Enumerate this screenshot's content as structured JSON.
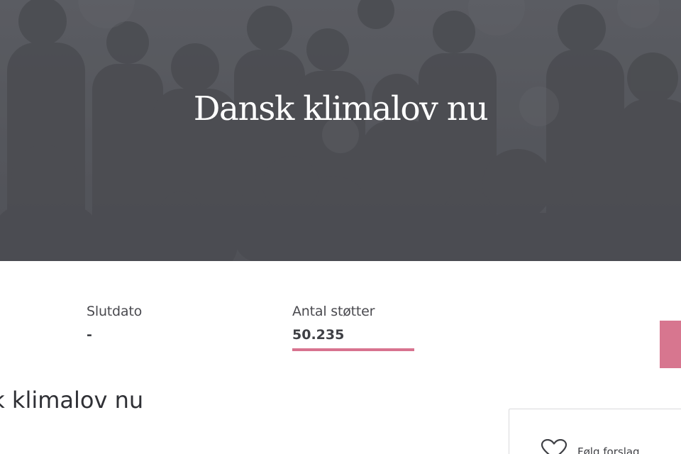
{
  "hero": {
    "title": "Dansk klimalov nu"
  },
  "stats": {
    "end_date": {
      "label": "Slutdato",
      "value": "-"
    },
    "supporters": {
      "label": "Antal støtter",
      "value": "50.235",
      "progress_fraction": 1.0
    }
  },
  "proposal": {
    "title": "Dansk klimalov nu"
  },
  "follow": {
    "label": "Følg forslag",
    "icon": "heart-icon"
  },
  "colors": {
    "accent": "#d7768f",
    "hero_overlay": "#55575c"
  }
}
